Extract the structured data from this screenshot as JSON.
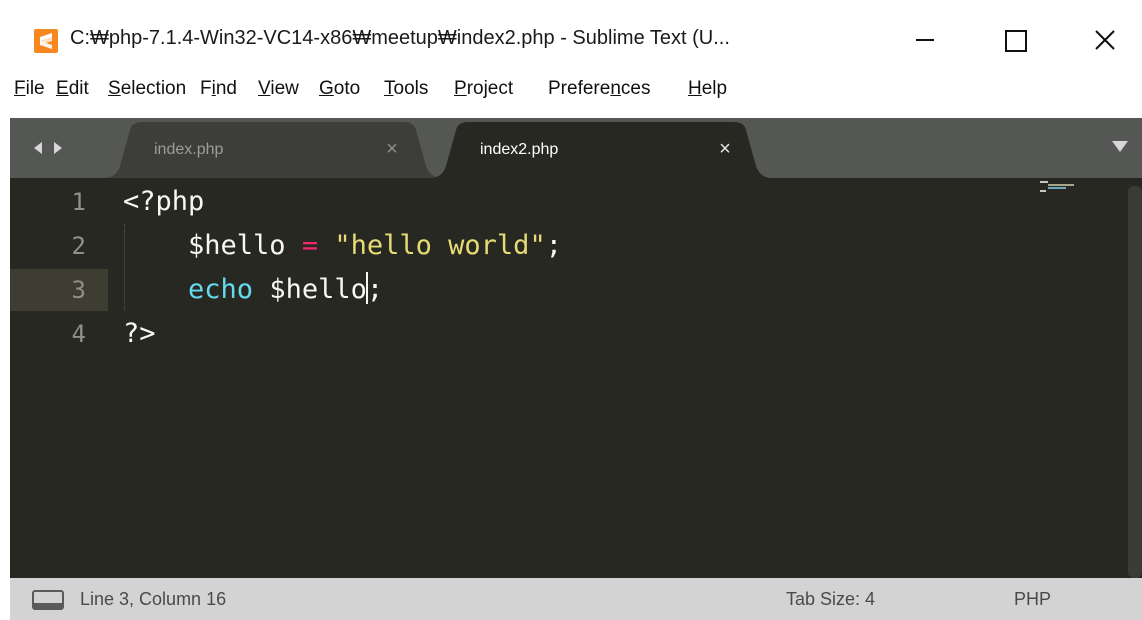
{
  "window": {
    "title": "C:₩php-7.1.4-Win32-VC14-x86₩meetup₩index2.php - Sublime Text (U...",
    "app_icon": "sublime-logo-icon",
    "controls": [
      "minimize-icon",
      "maximize-icon",
      "close-icon"
    ]
  },
  "menu": {
    "items": [
      {
        "pre": "",
        "acc": "F",
        "post": "ile"
      },
      {
        "pre": "",
        "acc": "E",
        "post": "dit"
      },
      {
        "pre": "",
        "acc": "S",
        "post": "election"
      },
      {
        "pre": "F",
        "acc": "i",
        "post": "nd"
      },
      {
        "pre": "",
        "acc": "V",
        "post": "iew"
      },
      {
        "pre": "",
        "acc": "G",
        "post": "oto"
      },
      {
        "pre": "",
        "acc": "T",
        "post": "ools"
      },
      {
        "pre": "",
        "acc": "P",
        "post": "roject"
      },
      {
        "pre": "Prefere",
        "acc": "n",
        "post": "ces"
      },
      {
        "pre": "",
        "acc": "H",
        "post": "elp"
      }
    ]
  },
  "tabs": [
    {
      "label": "index.php",
      "close": "×",
      "active": false
    },
    {
      "label": "index2.php",
      "close": "×",
      "active": true
    }
  ],
  "editor": {
    "line_numbers": [
      "1",
      "2",
      "3",
      "4"
    ],
    "current_line": 3,
    "code": {
      "line1": "<?php",
      "line2_indent": "    ",
      "line2_var": "$hello",
      "line2_op": "=",
      "line2_str": "\"hello world\"",
      "line2_end": ";",
      "line3_indent": "    ",
      "line3_kw": "echo",
      "line3_var_a": "$hell",
      "line3_var_b": "o",
      "line3_end": ";",
      "line4": "?>"
    }
  },
  "status": {
    "position": "Line 3, Column 16",
    "tab_size": "Tab Size: 4",
    "syntax": "PHP",
    "panel_icon": "console-panel-icon"
  },
  "colors": {
    "editor_bg": "#272822",
    "tabbar_bg": "#555754",
    "keyword": "#66d9ef",
    "operator": "#f92672",
    "string": "#e6db74",
    "default_text": "#f8f8f2",
    "statusbar_bg": "#d3d3d3"
  }
}
